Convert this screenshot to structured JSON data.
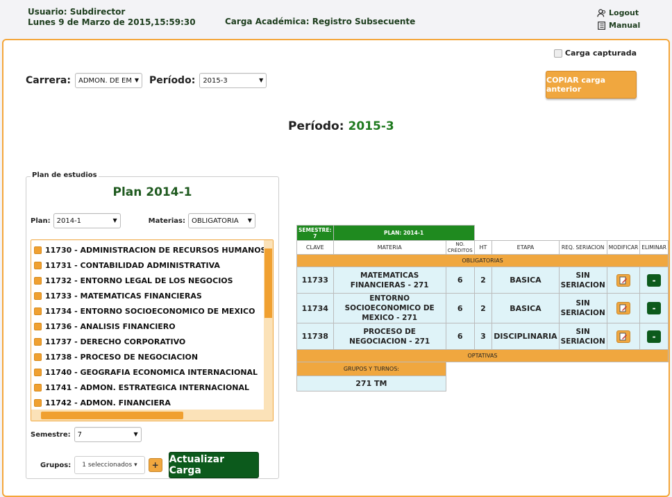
{
  "header": {
    "user": "Usuario: Subdirector",
    "datetime": "Lunes 9 de Marzo de 2015,15:59:30",
    "title": "Carga Académica: Registro Subsecuente",
    "logout": "Logout",
    "manual": "Manual"
  },
  "carga_capturada": "Carga capturada",
  "copy_button": "COPIAR carga anterior",
  "filters": {
    "carrera_label": "Carrera:",
    "carrera_value": "ADMON. DE EM",
    "periodo_label": "Período:",
    "periodo_value": "2015-3"
  },
  "periodo_heading": {
    "label": "Período:",
    "value": "2015-3"
  },
  "plan": {
    "legend": "Plan de estudios",
    "title": "Plan 2014-1",
    "plan_label": "Plan:",
    "plan_value": "2014-1",
    "materias_label": "Materias:",
    "materias_value": "OBLIGATORIA",
    "items": [
      "11730 - ADMINISTRACION DE RECURSOS HUMANOS",
      "11731 - CONTABILIDAD ADMINISTRATIVA",
      "11732 - ENTORNO LEGAL DE LOS NEGOCIOS",
      "11733 - MATEMATICAS FINANCIERAS",
      "11734 - ENTORNO SOCIOECONOMICO DE MEXICO",
      "11736 - ANALISIS FINANCIERO",
      "11737 - DERECHO CORPORATIVO",
      "11738 - PROCESO DE NEGOCIACION",
      "11740 - GEOGRAFIA ECONOMICA INTERNACIONAL",
      "11741 - ADMON. ESTRATEGICA INTERNACIONAL",
      "11742 - ADMON. FINANCIERA"
    ],
    "semestre_label": "Semestre:",
    "semestre_value": "7",
    "grupos_label": "Grupos:",
    "grupos_value": "1 seleccionados",
    "plus": "+",
    "actualizar": "Actualizar Carga"
  },
  "table": {
    "semestre_hdr": "SEMESTRE: 7",
    "plan_hdr": "PLAN: 2014-1",
    "columns": [
      "CLAVE",
      "MATERIA",
      "NO. CRÉDITOS",
      "HT",
      "ETAPA",
      "REQ. SERIACION",
      "MODIFICAR",
      "ELIMINAR"
    ],
    "obligatorias": "OBLIGATORIAS",
    "rows": [
      {
        "clave": "11733",
        "materia": "MATEMATICAS FINANCIERAS - 271",
        "creditos": "6",
        "ht": "2",
        "etapa": "BASICA",
        "req": "SIN SERIACION",
        "del": "-"
      },
      {
        "clave": "11734",
        "materia": "ENTORNO SOCIOECONOMICO DE MEXICO - 271",
        "creditos": "6",
        "ht": "2",
        "etapa": "BASICA",
        "req": "SIN SERIACION",
        "del": "-"
      },
      {
        "clave": "11738",
        "materia": "PROCESO DE NEGOCIACION - 271",
        "creditos": "6",
        "ht": "3",
        "etapa": "DISCIPLINARIA",
        "req": "SIN SERIACION",
        "del": "-"
      }
    ],
    "optativas": "OPTATIVAS",
    "grupos_turnos": "GRUPOS Y TURNOS:",
    "grupos_value": "271 TM"
  }
}
